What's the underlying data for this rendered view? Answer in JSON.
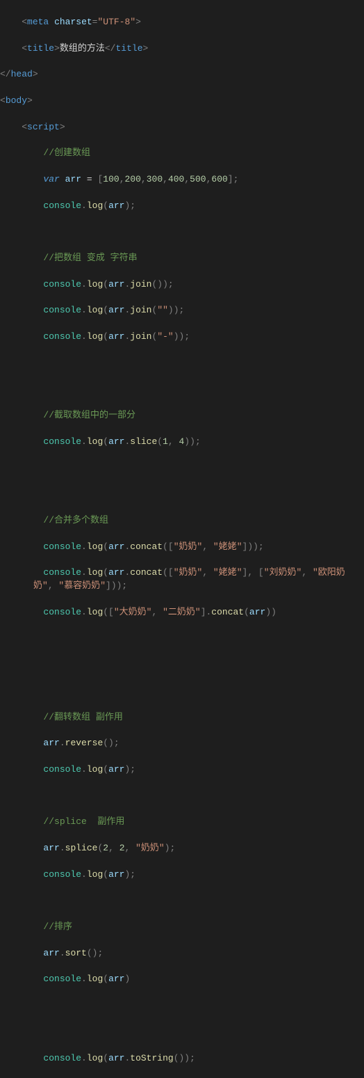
{
  "code": {
    "meta_charset": "UTF-8",
    "title_text": "数组的方法",
    "comment_create": "//创建数组",
    "kw_var": "var",
    "ident_arr": "arr",
    "nums": [
      "100",
      "200",
      "300",
      "400",
      "500",
      "600"
    ],
    "obj_console": "console",
    "fn_log": "log",
    "comment_join": "//把数组 变成 字符串",
    "fn_join": "join",
    "str_empty": "\"\"",
    "str_dash": "\"-\"",
    "comment_slice": "//截取数组中的一部分",
    "fn_slice": "slice",
    "n1": "1",
    "n4": "4",
    "comment_concat": "//合并多个数组",
    "fn_concat": "concat",
    "str_nainai": "\"奶奶\"",
    "str_laolao": "\"姥姥\"",
    "str_liunainai": "\"刘奶奶\"",
    "str_ouyang": "\"欧阳奶奶\"",
    "str_murong": "\"慕容奶奶\"",
    "str_danainai": "\"大奶奶\"",
    "str_ernainai": "\"二奶奶\"",
    "comment_reverse": "//翻转数组 副作用",
    "fn_reverse": "reverse",
    "comment_splice": "//splice  副作用",
    "fn_splice": "splice",
    "n2a": "2",
    "n2b": "2",
    "comment_sort": "//排序",
    "fn_sort": "sort",
    "fn_tostring": "toString"
  }
}
